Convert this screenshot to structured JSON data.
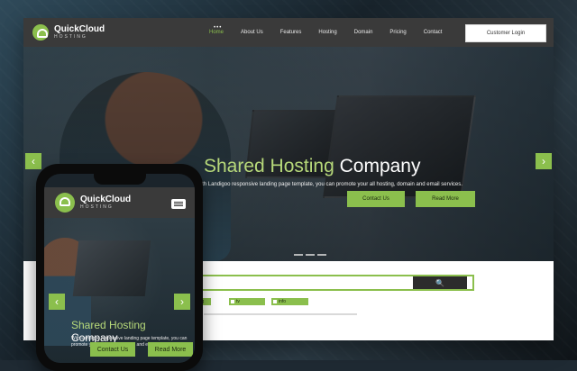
{
  "brand": {
    "name": "QuickCloud",
    "tagline": "HOSTING"
  },
  "nav": {
    "indicator": "•••",
    "items": [
      "Home",
      "About Us",
      "Features",
      "Hosting",
      "Domain",
      "Pricing",
      "Contact"
    ],
    "cta": "Customer Login"
  },
  "hero": {
    "title_accent": "Shared Hosting",
    "title_rest": " Company",
    "subtitle": "With Landigoo responsive landing page template, you can promote your all hosting, domain and email services.",
    "buttons": [
      "Contact Us",
      "Read More"
    ],
    "arrows": {
      "left": "‹",
      "right": "›"
    },
    "scroll_up": "⌃"
  },
  "domain_search": {
    "search_icon": "🔍",
    "tlds": [
      "org",
      "tv",
      "info"
    ]
  },
  "mobile": {
    "title_accent": "Shared Hosting",
    "title_rest": " Company",
    "subtitle": "With Landigoo responsive landing page template, you can promote your all hosting domain and email services.",
    "buttons": [
      "Contact Us",
      "Read More"
    ],
    "arrows": {
      "left": "‹",
      "right": "›"
    }
  },
  "colors": {
    "accent": "#8bbf4d",
    "nav_bg": "#3a3a3a"
  }
}
